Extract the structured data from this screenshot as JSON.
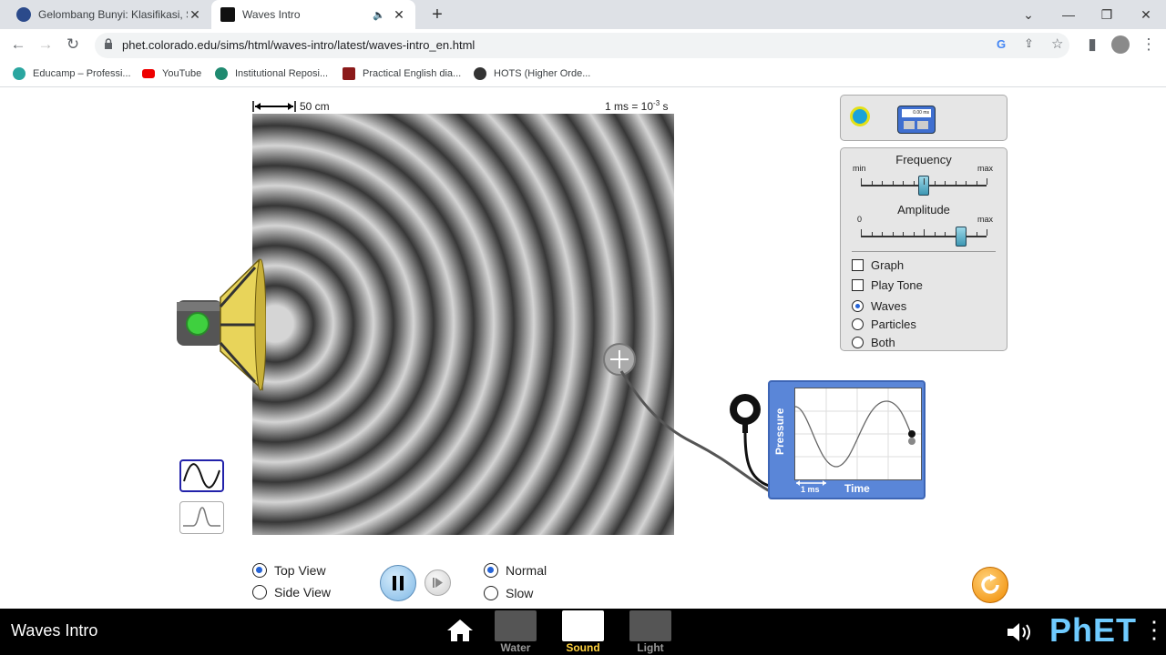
{
  "browser": {
    "tabs": [
      {
        "title": "Gelombang Bunyi: Klasifikasi, Sifat",
        "active": false
      },
      {
        "title": "Waves Intro",
        "active": true
      }
    ],
    "url": "phet.colorado.edu/sims/html/waves-intro/latest/waves-intro_en.html",
    "bookmarks": [
      "Educamp – Professi...",
      "YouTube",
      "Institutional Reposi...",
      "Practical English dia...",
      "HOTS (Higher Orde..."
    ]
  },
  "sim": {
    "scale_label": "50 cm",
    "time_scale": {
      "prefix": "1 ms = 10",
      "exp": "-3",
      "suffix": " s"
    },
    "controls": {
      "frequency": {
        "label": "Frequency",
        "min_label": "min",
        "max_label": "max",
        "value_fraction": 0.5
      },
      "amplitude": {
        "label": "Amplitude",
        "min_label": "0",
        "max_label": "max",
        "value_fraction": 0.8
      },
      "checkboxes": [
        {
          "label": "Graph",
          "checked": false
        },
        {
          "label": "Play Tone",
          "checked": false
        }
      ],
      "radios": [
        {
          "label": "Waves",
          "selected": true
        },
        {
          "label": "Particles",
          "selected": false
        },
        {
          "label": "Both",
          "selected": false
        }
      ]
    },
    "stopwatch_display": "0.00 ms",
    "meter": {
      "y_label": "Pressure",
      "x_label": "Time",
      "scale_label": "1 ms"
    },
    "view_options": [
      {
        "label": "Top View",
        "selected": true
      },
      {
        "label": "Side View",
        "selected": false
      }
    ],
    "speed_options": [
      {
        "label": "Normal",
        "selected": true
      },
      {
        "label": "Slow",
        "selected": false
      }
    ]
  },
  "navbar": {
    "title": "Waves Intro",
    "screens": [
      {
        "label": "Water",
        "selected": false
      },
      {
        "label": "Sound",
        "selected": true
      },
      {
        "label": "Light",
        "selected": false
      }
    ],
    "brand": "PhET"
  }
}
